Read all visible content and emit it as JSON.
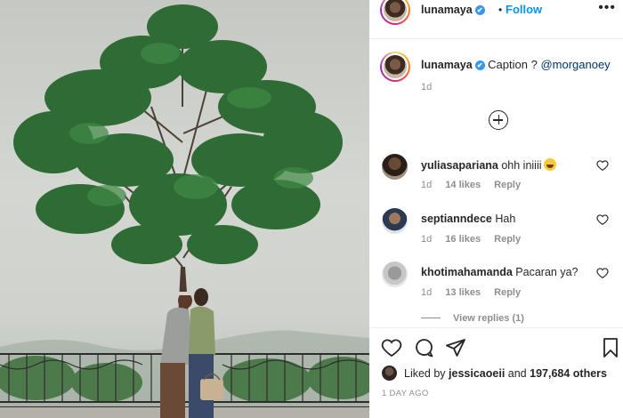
{
  "post": {
    "username": "lunamaya",
    "verified_mark": "✔",
    "separator": "•",
    "follow_label": "Follow",
    "more_label": "•••"
  },
  "caption": {
    "username": "lunamaya",
    "text": "Caption ?",
    "mention": "@morganoey",
    "time": "1d"
  },
  "comments": [
    {
      "username": "yuliasapariana",
      "text": "ohh iniiii",
      "emoji": "grinning-squint-face",
      "time": "1d",
      "likes": "14 likes",
      "reply": "Reply"
    },
    {
      "username": "septianndece",
      "text": "Hah",
      "time": "1d",
      "likes": "16 likes",
      "reply": "Reply"
    },
    {
      "username": "khotimahamanda",
      "text": "Pacaran ya?",
      "time": "1d",
      "likes": "13 likes",
      "reply": "Reply"
    }
  ],
  "view_replies": "View replies (1)",
  "likes": {
    "prefix": "Liked by",
    "user": "jessicaoeii",
    "and": "and",
    "count": "197,684 others"
  },
  "post_time": "1 DAY AGO",
  "icons": {
    "like": "heart-icon",
    "comment": "comment-icon",
    "share": "share-icon",
    "save": "bookmark-icon",
    "load_more": "plus-circle-icon"
  },
  "colors": {
    "link_blue": "#0095f6",
    "mention_blue": "#00376b",
    "secondary_text": "#8e8e8e",
    "verified": "#3897f0"
  }
}
